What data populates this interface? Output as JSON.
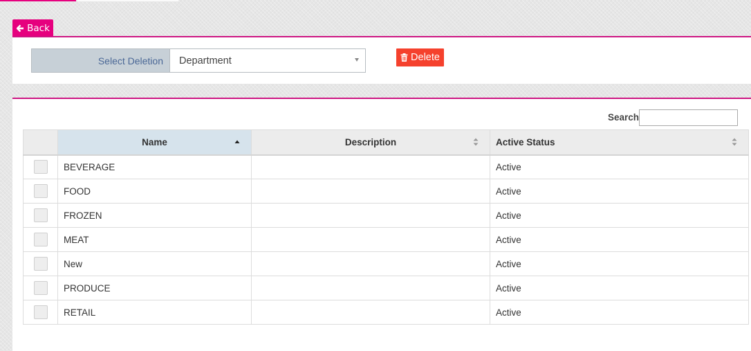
{
  "nav": {
    "back_label": "Back"
  },
  "deletion": {
    "label": "Select Deletion",
    "selected_value": "Department",
    "delete_label": "Delete"
  },
  "search": {
    "label": "Search:",
    "value": ""
  },
  "table": {
    "headers": {
      "name": "Name",
      "description": "Description",
      "status": "Active Status"
    },
    "rows": [
      {
        "name": "BEVERAGE",
        "description": "",
        "status": "Active"
      },
      {
        "name": "FOOD",
        "description": "",
        "status": "Active"
      },
      {
        "name": "FROZEN",
        "description": "",
        "status": "Active"
      },
      {
        "name": "MEAT",
        "description": "",
        "status": "Active"
      },
      {
        "name": "New",
        "description": "",
        "status": "Active"
      },
      {
        "name": "PRODUCE",
        "description": "",
        "status": "Active"
      },
      {
        "name": "RETAIL",
        "description": "",
        "status": "Active"
      }
    ]
  },
  "colors": {
    "accent": "#e6007e",
    "danger": "#f5412d",
    "status_active": "#1d8a1d",
    "sorted_header": "#d6e3ec"
  },
  "icons": {
    "back": "arrow-left-icon",
    "delete": "trash-icon",
    "sort_ascending": "sort-ascending-icon",
    "sortable": "sort-both-icon",
    "dropdown": "caret-down-icon"
  }
}
